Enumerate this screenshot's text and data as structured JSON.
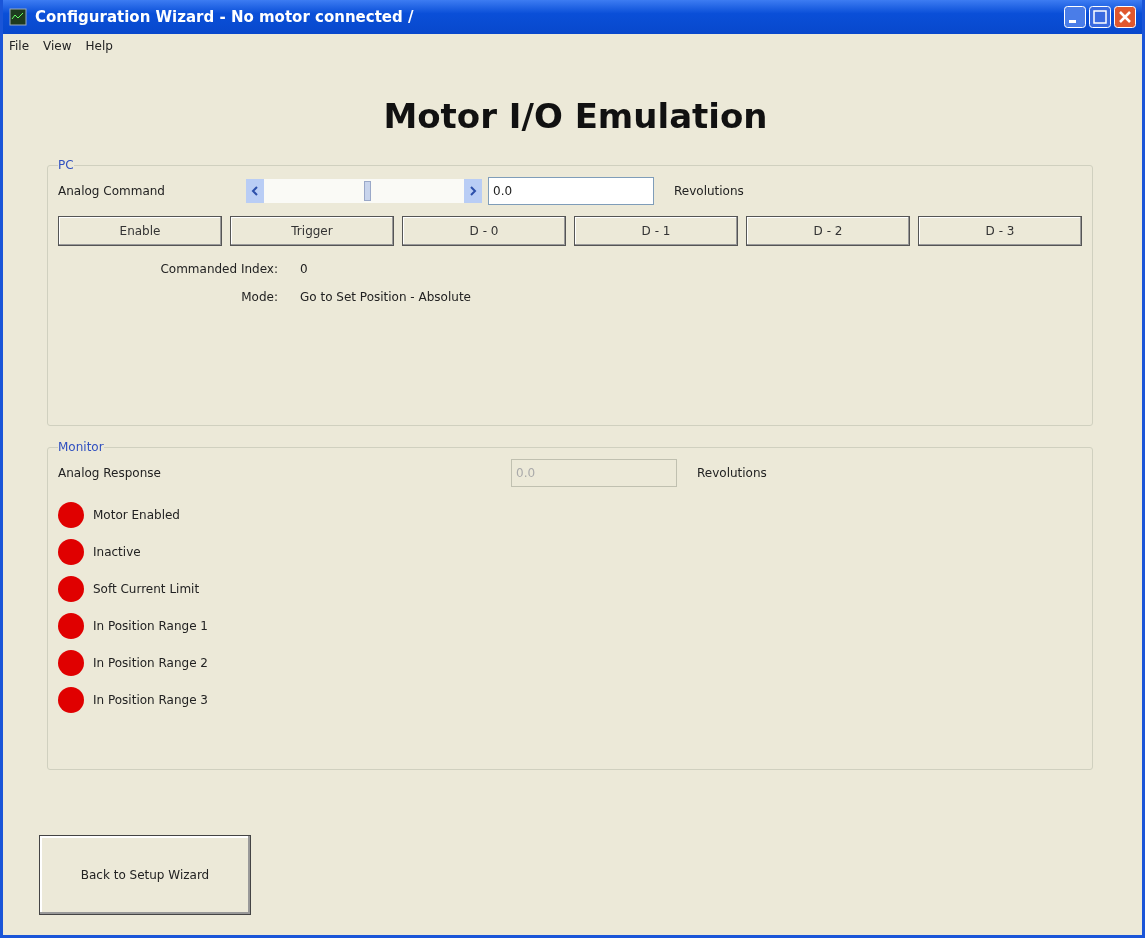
{
  "window": {
    "title": "Configuration Wizard  - No motor connected /"
  },
  "menu": [
    "File",
    "View",
    "Help"
  ],
  "heading": "Motor I/O Emulation",
  "pc": {
    "label": "PC",
    "analog_label": "Analog Command",
    "slider": {
      "level": 0.52
    },
    "value": "0.0",
    "unit": "Revolutions",
    "buttons": [
      "Enable",
      "Trigger",
      "D - 0",
      "D - 1",
      "D - 2",
      "D - 3"
    ],
    "info": [
      {
        "label": "Commanded Index:",
        "value": "0"
      },
      {
        "label": "Mode:",
        "value": "Go to Set Position - Absolute"
      }
    ]
  },
  "monitor": {
    "label": "Monitor",
    "analog_label": "Analog Response",
    "value": "0.0",
    "disabled": true,
    "unit": "Revolutions",
    "indicators": [
      {
        "label": "Motor Enabled",
        "color": "#e00000"
      },
      {
        "label": "Inactive",
        "color": "#e00000"
      },
      {
        "label": "Soft Current Limit",
        "color": "#e00000"
      },
      {
        "label": "In Position Range 1",
        "color": "#e00000"
      },
      {
        "label": "In Position Range 2",
        "color": "#e00000"
      },
      {
        "label": "In Position Range 3",
        "color": "#e00000"
      }
    ]
  },
  "back_button": "Back to Setup Wizard"
}
